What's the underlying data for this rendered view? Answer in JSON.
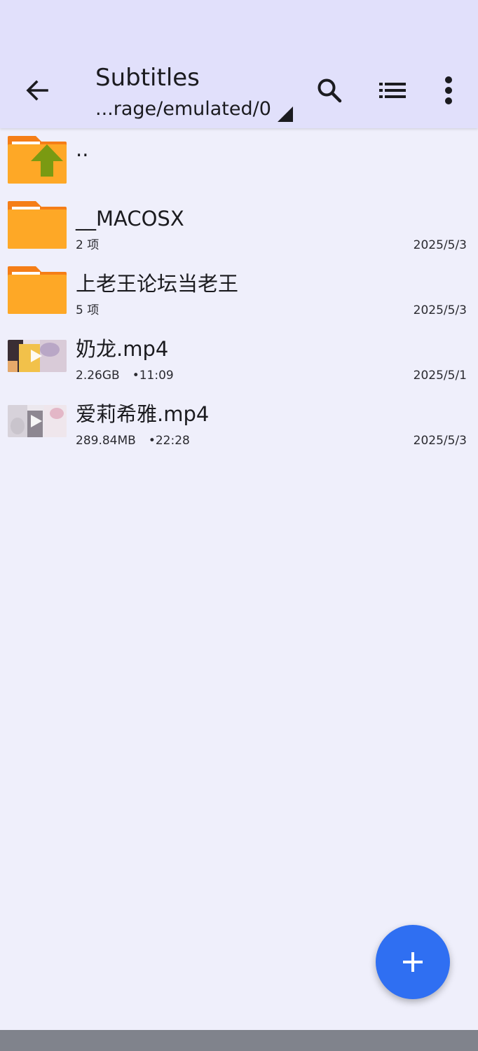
{
  "appbar": {
    "title": "Subtitles",
    "path": "...rage/emulated/0",
    "icons": [
      "back-arrow-icon",
      "search-icon",
      "list-view-icon",
      "more-vertical-icon"
    ]
  },
  "files": [
    {
      "kind": "parent",
      "name": "..",
      "icon": "folder-up-icon"
    },
    {
      "kind": "folder",
      "name": "__MACOSX",
      "meta": "2 项",
      "date": "2025/5/3",
      "icon": "folder-icon"
    },
    {
      "kind": "folder",
      "name": "上老王论坛当老王",
      "meta": "5 项",
      "date": "2025/5/3",
      "icon": "folder-icon"
    },
    {
      "kind": "video",
      "name": "奶龙.mp4",
      "size": "2.26GB",
      "duration": "•11:09",
      "date": "2025/5/1",
      "icon": "video-thumbnail"
    },
    {
      "kind": "video",
      "name": "爱莉希雅.mp4",
      "size": "289.84MB",
      "duration": "•22:28",
      "date": "2025/5/3",
      "icon": "video-thumbnail"
    }
  ],
  "fab": {
    "icon": "plus-icon"
  },
  "colors": {
    "appbar_bg": "#e1e0fb",
    "page_bg": "#efeffb",
    "folder_orange": "#fea826",
    "folder_tab": "#f57e17",
    "up_arrow": "#7a9a12",
    "fab": "#2f6ff2",
    "nav_bar": "#80838c"
  }
}
